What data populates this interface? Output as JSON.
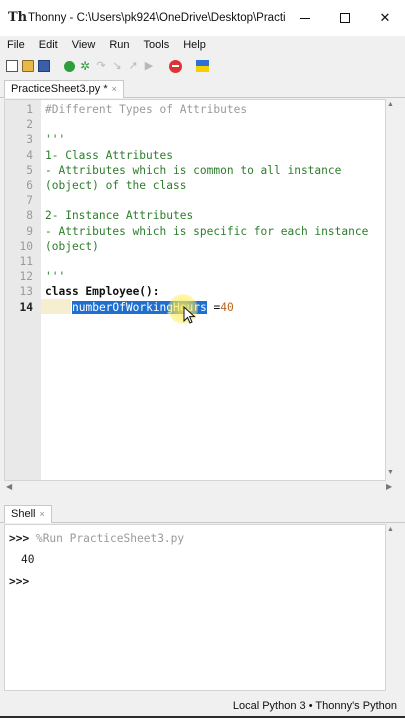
{
  "window": {
    "title": "Thonny  -  C:\\Users\\pk924\\OneDrive\\Desktop\\Practice...",
    "minimize_glyph": "—",
    "close_glyph": "✕"
  },
  "menu": {
    "items": [
      "File",
      "Edit",
      "View",
      "Run",
      "Tools",
      "Help"
    ]
  },
  "toolbar": {
    "icons": [
      "new-file-icon",
      "open-file-icon",
      "save-icon",
      "run-icon",
      "debug-icon",
      "step-over-icon",
      "step-into-icon",
      "step-out-icon",
      "resume-icon",
      "stop-icon",
      "ukraine-flag-icon"
    ]
  },
  "editor": {
    "tab_label": "PracticeSheet3.py *",
    "tab_close": "×",
    "lines": [
      {
        "n": "1",
        "text": "#Different Types of Attributes"
      },
      {
        "n": "2",
        "text": ""
      },
      {
        "n": "3",
        "text": "'''"
      },
      {
        "n": "4",
        "text": "1- Class Attributes"
      },
      {
        "n": "5",
        "text": "- Attributes which is common to all instance"
      },
      {
        "n": "6",
        "text": "(object) of the class"
      },
      {
        "n": "7",
        "text": ""
      },
      {
        "n": "8",
        "text": "2- Instance Attributes"
      },
      {
        "n": "9",
        "text": "- Attributes which is specific for each instance"
      },
      {
        "n": "10",
        "text": "(object)"
      },
      {
        "n": "11",
        "text": ""
      },
      {
        "n": "12",
        "text": "'''"
      },
      {
        "n": "13",
        "kw": "class",
        "rest": " Employee():"
      },
      {
        "n": "14",
        "selected": "numberOfWorkingHours",
        "rest": " =",
        "num": "40"
      }
    ]
  },
  "shell": {
    "tab_label": "Shell",
    "tab_close": "×",
    "prompt": ">>>",
    "command": " %Run PracticeSheet3.py",
    "output": "40"
  },
  "status": {
    "interpreter": "Local Python 3  •  Thonny's Python"
  },
  "colors": {
    "selection": "#1f6fd0",
    "string": "#2d7d2d",
    "number": "#b5651d",
    "comment": "#9a9a9a"
  }
}
